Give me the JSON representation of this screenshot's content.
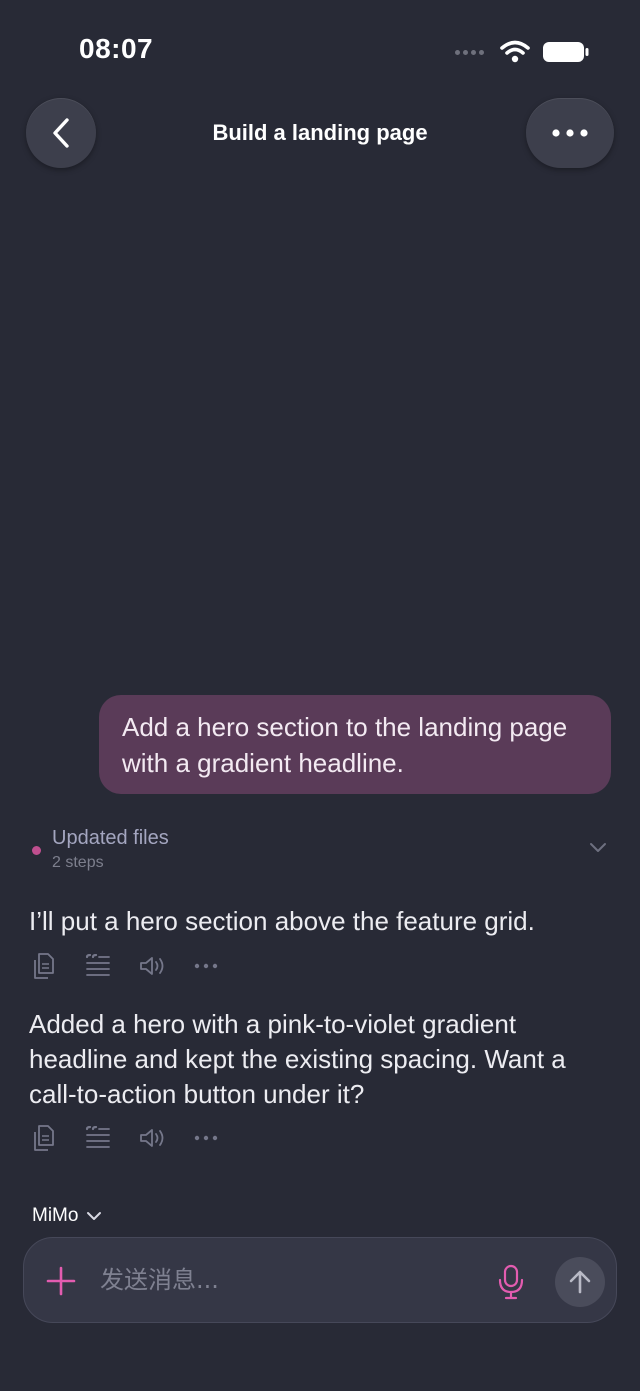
{
  "status_bar": {
    "time": "08:07"
  },
  "nav": {
    "title": "Build a landing page"
  },
  "user_message": {
    "text": "Add a hero section to the landing page with a gradient headline."
  },
  "steps": {
    "title": "Updated files",
    "subtitle": "2 steps"
  },
  "assistant_messages": [
    {
      "text": "I’ll put a hero section above the feature grid."
    },
    {
      "text": "Added a hero with a pink-to-violet gradient headline and kept the existing spacing. Want a call-to-action button under it?"
    }
  ],
  "message_actions": [
    "copy-icon",
    "quote-icon",
    "speaker-icon",
    "more-icon"
  ],
  "model_selector": {
    "name": "MiMo"
  },
  "composer": {
    "placeholder": "发送消息..."
  },
  "colors": {
    "background": "#282a36",
    "user_bubble": "#5a3b58",
    "accent_pink": "#e35cb0",
    "step_dot": "#c04f8f"
  }
}
